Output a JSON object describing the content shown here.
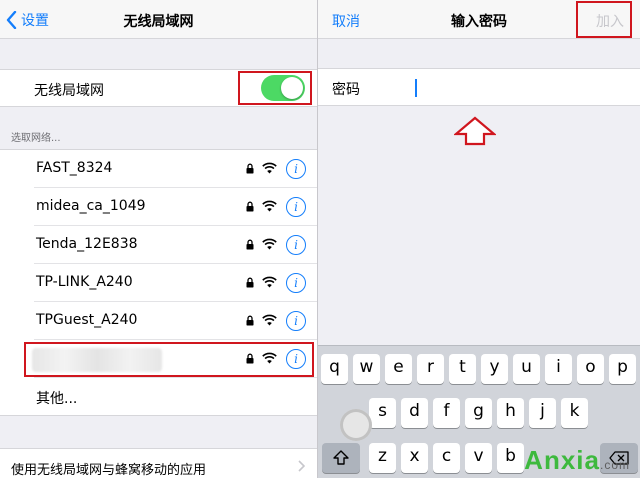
{
  "left_nav": {
    "back_label": "设置",
    "title": "无线局域网"
  },
  "wifi_toggle": {
    "label": "无线局域网",
    "on": true
  },
  "section_header": "选取网络...",
  "networks": [
    {
      "name": "FAST_8324"
    },
    {
      "name": "midea_ca_1049"
    },
    {
      "name": "Tenda_12E838"
    },
    {
      "name": "TP-LINK_A240"
    },
    {
      "name": "TPGuest_A240"
    },
    {
      "name": ""
    }
  ],
  "other_label": "其他...",
  "bottom_row_label": "使用无线局域网与蜂窝移动的应用",
  "right_nav": {
    "cancel_label": "取消",
    "title": "输入密码",
    "join_label": "加入"
  },
  "password": {
    "label": "密码",
    "value": ""
  },
  "keyboard": {
    "row1": [
      "q",
      "w",
      "e",
      "r",
      "t",
      "y",
      "u",
      "i",
      "o",
      "p"
    ],
    "row2": [
      "s",
      "d",
      "f",
      "g",
      "h",
      "j",
      "k"
    ],
    "row3": [
      "z",
      "x",
      "c",
      "v",
      "b"
    ]
  },
  "watermark": {
    "text": "Anxia",
    "suffix": ".com"
  },
  "colors": {
    "accent": "#147efb",
    "toggle_on": "#4cd964",
    "highlight": "#d0161e",
    "watermark": "#2fb72e"
  }
}
